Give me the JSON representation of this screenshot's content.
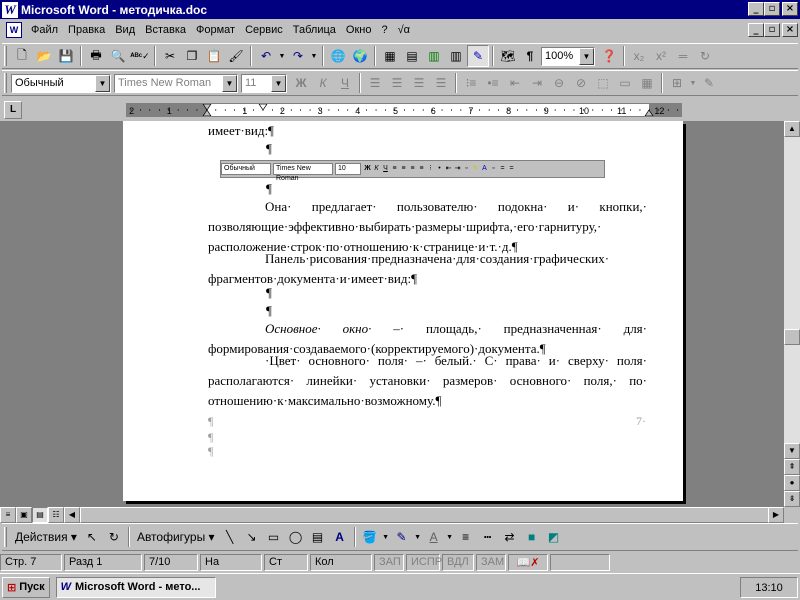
{
  "window": {
    "title": "Microsoft Word - методичка.doc",
    "app_icon": "W",
    "buttons": {
      "minimize": "_",
      "maximize": "▫",
      "close": "×"
    }
  },
  "menu": {
    "items": [
      "Файл",
      "Правка",
      "Вид",
      "Вставка",
      "Формат",
      "Сервис",
      "Таблица",
      "Окно",
      "?",
      "√α"
    ],
    "doc_icon": "W"
  },
  "standard_toolbar": {
    "zoom": "100%",
    "icons": [
      "new-icon",
      "open-icon",
      "save-icon",
      "print-icon",
      "print-preview-icon",
      "spelling-icon",
      "cut-icon",
      "copy-icon",
      "paste-icon",
      "format-painter-icon",
      "undo-icon",
      "redo-icon",
      "hyperlink-icon",
      "web-toolbar-icon",
      "tables-borders-icon",
      "insert-table-icon",
      "insert-excel-icon",
      "columns-icon",
      "drawing-icon",
      "document-map-icon",
      "show-hide-icon",
      "help-icon"
    ]
  },
  "formatting_toolbar": {
    "style": "Обычный",
    "font": "Times New Roman",
    "size": "11",
    "bold": "Ж",
    "italic": "К",
    "underline": "Ч"
  },
  "ruler": {
    "tab_label": "L",
    "marks": [
      "2",
      "1",
      "1",
      "2",
      "3",
      "4",
      "5",
      "6",
      "7",
      "8",
      "9",
      "10",
      "11",
      "12"
    ]
  },
  "document": {
    "pilcrow": "¶",
    "line_top": "имеет·вид:¶",
    "para1": "Она· предлагает· пользователю· подокна· и· кнопки,· позволяющие·эффективно·выбирать·размеры·шрифта,·его·гарнитуру,· расположение·строк·по·отношению·к·странице·и·т.·д.¶",
    "para2": "Панель·рисования·предназначена·для·создания·графических· фрагментов·документа·и·имеет·вид:¶",
    "para3_em": "Основное· окно·",
    "para3_rest": " –· площадь,· предназначенная· для· формирования·создаваемого·(корректируемого)·документа.¶",
    "para4": "·Цвет· основного· поля· –· белый.· С· права· и· сверху· поля· располагаются· линейки· установки· размеров· основного· поля,· по· отношению·к·максимально·возможному.¶",
    "page_number": "7·",
    "mini_toolbar": {
      "style": "Обычный",
      "font": "Times New Roman",
      "size": "10"
    }
  },
  "drawing_toolbar": {
    "actions": "Действия",
    "autoshapes": "Автофигуры"
  },
  "status_bar": {
    "page": "Стр. 7",
    "section": "Разд 1",
    "pages": "7/10",
    "at": "На",
    "line": "Ст",
    "col": "Кол",
    "rec": "ЗАП",
    "trk": "ИСПР",
    "ext": "ВДЛ",
    "ovr": "ЗАМ"
  },
  "taskbar": {
    "start": "Пуск",
    "task": "Microsoft Word - мето...",
    "clock": "13:10"
  }
}
